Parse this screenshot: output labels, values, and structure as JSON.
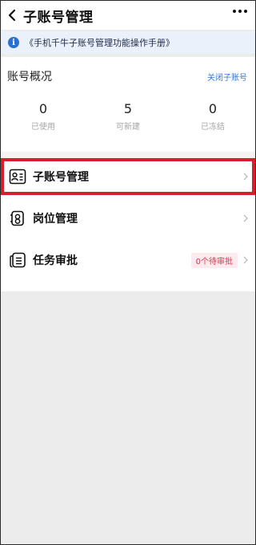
{
  "header": {
    "title": "子账号管理"
  },
  "banner": {
    "text": "《手机千牛子账号管理功能操作手册》"
  },
  "overview": {
    "title": "账号概况",
    "link": "关闭子账号",
    "stats": [
      {
        "value": "0",
        "label": "已使用"
      },
      {
        "value": "5",
        "label": "可新建"
      },
      {
        "value": "0",
        "label": "已冻结"
      }
    ]
  },
  "menu": [
    {
      "label": "子账号管理",
      "icon": "user-list-icon"
    },
    {
      "label": "岗位管理",
      "icon": "badge-icon"
    },
    {
      "label": "任务审批",
      "icon": "document-list-icon",
      "badge": "0个待审批"
    }
  ],
  "colors": {
    "accent": "#3a76d6",
    "highlight": "#d7202d",
    "badge_text": "#e0324f"
  }
}
